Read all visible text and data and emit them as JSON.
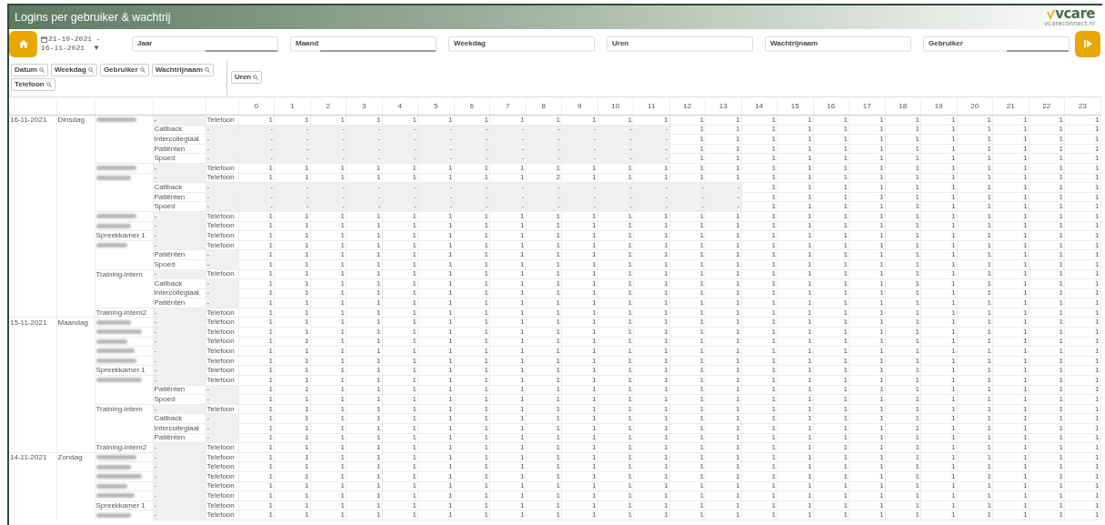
{
  "window": {
    "title": "Logins per gebruiker & wachtrij"
  },
  "logo": {
    "text": "vcare",
    "subtitle": "vcareconnect.nl"
  },
  "date_range": {
    "from_line": "21-10-2021 -",
    "to_line": "16-11-2021",
    "caret": "▼"
  },
  "filters": [
    {
      "label": "Jaar",
      "level": 0.5
    },
    {
      "label": "Maand",
      "level": 0.8
    },
    {
      "label": "Weekdag",
      "level": 0
    },
    {
      "label": "Uren",
      "level": 0
    },
    {
      "label": "Wachtrijnaam",
      "level": 0
    },
    {
      "label": "Gebruiker",
      "level": 0.43
    }
  ],
  "row_chips": [
    "Datum",
    "Weekdag",
    "Gebruiker",
    "Wachtrijnaam",
    "Telefoon"
  ],
  "column_chips": [
    "Uren"
  ],
  "hour_columns": [
    "0",
    "1",
    "2",
    "3",
    "4",
    "5",
    "6",
    "7",
    "8",
    "9",
    "10",
    "11",
    "12",
    "13",
    "14",
    "15",
    "16",
    "17",
    "18",
    "19",
    "20",
    "21",
    "22",
    "23"
  ],
  "rows": [
    {
      "date": "16-11-2021",
      "weekday": "Dinsdag",
      "user_redacted": true,
      "queue": {
        "text": "-",
        "empty": true
      },
      "phone": "Telefoon",
      "hours": [
        "1",
        "1",
        "1",
        "1",
        "1",
        "1",
        "1",
        "1",
        "1",
        "1",
        "1",
        "1",
        "1",
        "1",
        "1",
        "1",
        "1",
        "1",
        "1",
        "1",
        "1",
        "1",
        "1",
        "1"
      ]
    },
    {
      "queue": "Callback",
      "phone": {
        "text": "-",
        "empty": true
      },
      "hours": [
        {
          "text": "-",
          "empty": true
        },
        {
          "text": "-",
          "empty": true
        },
        {
          "text": "-",
          "empty": true
        },
        {
          "text": "-",
          "empty": true
        },
        {
          "text": "-",
          "empty": true
        },
        {
          "text": "-",
          "empty": true
        },
        {
          "text": "-",
          "empty": true
        },
        {
          "text": "-",
          "empty": true
        },
        {
          "text": "-",
          "empty": true
        },
        {
          "text": "-",
          "empty": true
        },
        {
          "text": "-",
          "empty": true
        },
        {
          "text": "-",
          "empty": true
        },
        "1",
        "1",
        "1",
        "1",
        "1",
        "1",
        "1",
        "1",
        "1",
        "1",
        "1",
        "1"
      ]
    },
    {
      "queue": "Intercollegiaal",
      "phone": {
        "text": "-",
        "empty": true
      },
      "hours": [
        {
          "text": "-",
          "empty": true
        },
        {
          "text": "-",
          "empty": true
        },
        {
          "text": "-",
          "empty": true
        },
        {
          "text": "-",
          "empty": true
        },
        {
          "text": "-",
          "empty": true
        },
        {
          "text": "-",
          "empty": true
        },
        {
          "text": "-",
          "empty": true
        },
        {
          "text": "-",
          "empty": true
        },
        {
          "text": "-",
          "empty": true
        },
        {
          "text": "-",
          "empty": true
        },
        {
          "text": "-",
          "empty": true
        },
        {
          "text": "-",
          "empty": true
        },
        "1",
        "1",
        "1",
        "1",
        "1",
        "1",
        "1",
        "1",
        "1",
        "1",
        "1",
        "1"
      ]
    },
    {
      "queue": "Patiënten",
      "phone": {
        "text": "-",
        "empty": true
      },
      "hours": [
        {
          "text": "-",
          "empty": true
        },
        {
          "text": "-",
          "empty": true
        },
        {
          "text": "-",
          "empty": true
        },
        {
          "text": "-",
          "empty": true
        },
        {
          "text": "-",
          "empty": true
        },
        {
          "text": "-",
          "empty": true
        },
        {
          "text": "-",
          "empty": true
        },
        {
          "text": "-",
          "empty": true
        },
        {
          "text": "-",
          "empty": true
        },
        {
          "text": "-",
          "empty": true
        },
        {
          "text": "-",
          "empty": true
        },
        {
          "text": "-",
          "empty": true
        },
        "1",
        "1",
        "1",
        "1",
        "1",
        "1",
        "1",
        "1",
        "1",
        "1",
        "1",
        "1"
      ]
    },
    {
      "queue": "Spoed",
      "phone": {
        "text": "-",
        "empty": true
      },
      "hours": [
        {
          "text": "-",
          "empty": true
        },
        {
          "text": "-",
          "empty": true
        },
        {
          "text": "-",
          "empty": true
        },
        {
          "text": "-",
          "empty": true
        },
        {
          "text": "-",
          "empty": true
        },
        {
          "text": "-",
          "empty": true
        },
        {
          "text": "-",
          "empty": true
        },
        {
          "text": "-",
          "empty": true
        },
        {
          "text": "-",
          "empty": true
        },
        {
          "text": "-",
          "empty": true
        },
        {
          "text": "-",
          "empty": true
        },
        {
          "text": "-",
          "empty": true
        },
        "1",
        "1",
        "1",
        "1",
        "1",
        "1",
        "1",
        "1",
        "1",
        "1",
        "1",
        "1"
      ]
    },
    {
      "user_redacted": true,
      "queue": {
        "text": "-",
        "empty": true
      },
      "phone": "Telefoon",
      "hours": [
        "1",
        "1",
        "1",
        "1",
        "1",
        "1",
        "1",
        "1",
        "1",
        "1",
        "1",
        "1",
        "1",
        "1",
        "1",
        "1",
        "1",
        "1",
        "1",
        "1",
        "1",
        "1",
        "1",
        "1"
      ]
    },
    {
      "user_redacted": true,
      "queue": {
        "text": "-",
        "empty": true
      },
      "phone": "Telefoon",
      "hours": [
        "1",
        "1",
        "1",
        "1",
        "1",
        "1",
        "1",
        "1",
        "2",
        "1",
        "1",
        "1",
        "1",
        "1",
        "1",
        "1",
        "1",
        "1",
        "1",
        "1",
        "1",
        "1",
        "1",
        "1"
      ]
    },
    {
      "queue": "Callback",
      "phone": {
        "text": "-",
        "empty": true
      },
      "hours": [
        {
          "text": "-",
          "empty": true
        },
        {
          "text": "-",
          "empty": true
        },
        {
          "text": "-",
          "empty": true
        },
        {
          "text": "-",
          "empty": true
        },
        {
          "text": "-",
          "empty": true
        },
        {
          "text": "-",
          "empty": true
        },
        {
          "text": "-",
          "empty": true
        },
        {
          "text": "-",
          "empty": true
        },
        {
          "text": "-",
          "empty": true
        },
        {
          "text": "-",
          "empty": true
        },
        {
          "text": "-",
          "empty": true
        },
        {
          "text": "-",
          "empty": true
        },
        {
          "text": "-",
          "empty": true
        },
        {
          "text": "-",
          "empty": true
        },
        "1",
        "1",
        "1",
        "1",
        "1",
        "1",
        "1",
        "1",
        "1",
        "1"
      ]
    },
    {
      "queue": "Patiënten",
      "phone": {
        "text": "-",
        "empty": true
      },
      "hours": [
        {
          "text": "-",
          "empty": true
        },
        {
          "text": "-",
          "empty": true
        },
        {
          "text": "-",
          "empty": true
        },
        {
          "text": "-",
          "empty": true
        },
        {
          "text": "-",
          "empty": true
        },
        {
          "text": "-",
          "empty": true
        },
        {
          "text": "-",
          "empty": true
        },
        {
          "text": "-",
          "empty": true
        },
        {
          "text": "-",
          "empty": true
        },
        {
          "text": "-",
          "empty": true
        },
        {
          "text": "-",
          "empty": true
        },
        {
          "text": "-",
          "empty": true
        },
        {
          "text": "-",
          "empty": true
        },
        {
          "text": "-",
          "empty": true
        },
        "1",
        "1",
        "1",
        "1",
        "1",
        "1",
        "1",
        "1",
        "1",
        "1"
      ]
    },
    {
      "queue": "Spoed",
      "phone": {
        "text": "-",
        "empty": true
      },
      "hours": [
        {
          "text": "-",
          "empty": true
        },
        {
          "text": "-",
          "empty": true
        },
        {
          "text": "-",
          "empty": true
        },
        {
          "text": "-",
          "empty": true
        },
        {
          "text": "-",
          "empty": true
        },
        {
          "text": "-",
          "empty": true
        },
        {
          "text": "-",
          "empty": true
        },
        {
          "text": "-",
          "empty": true
        },
        {
          "text": "-",
          "empty": true
        },
        {
          "text": "-",
          "empty": true
        },
        {
          "text": "-",
          "empty": true
        },
        {
          "text": "-",
          "empty": true
        },
        {
          "text": "-",
          "empty": true
        },
        {
          "text": "-",
          "empty": true
        },
        "1",
        "1",
        "1",
        "1",
        "1",
        "1",
        "1",
        "1",
        "1",
        "1"
      ]
    },
    {
      "user_redacted": true,
      "queue": {
        "text": "-",
        "empty": true
      },
      "phone": "Telefoon",
      "hours": [
        "1",
        "1",
        "1",
        "1",
        "1",
        "1",
        "1",
        "1",
        "1",
        "1",
        "1",
        "1",
        "1",
        "1",
        "1",
        "1",
        "1",
        "1",
        "1",
        "1",
        "1",
        "1",
        "1",
        "1"
      ]
    },
    {
      "user_redacted": true,
      "queue": {
        "text": "-",
        "empty": true
      },
      "phone": "Telefoon",
      "hours": [
        "1",
        "1",
        "1",
        "1",
        "1",
        "1",
        "1",
        "1",
        "1",
        "1",
        "1",
        "1",
        "1",
        "1",
        "1",
        "1",
        "1",
        "1",
        "1",
        "1",
        "1",
        "1",
        "1",
        "1"
      ]
    },
    {
      "user": "Spreekkamer 1",
      "queue": {
        "text": "-",
        "empty": true
      },
      "phone": "Telefoon",
      "hours": [
        "1",
        "1",
        "1",
        "1",
        "1",
        "1",
        "1",
        "1",
        "1",
        "1",
        "1",
        "1",
        "1",
        "1",
        "1",
        "1",
        "1",
        "1",
        "1",
        "1",
        "1",
        "1",
        "1",
        "1"
      ]
    },
    {
      "user_redacted": true,
      "queue": {
        "text": "-",
        "empty": true
      },
      "phone": "Telefoon",
      "hours": [
        "1",
        "1",
        "1",
        "1",
        "1",
        "1",
        "1",
        "1",
        "1",
        "1",
        "1",
        "1",
        "1",
        "1",
        "1",
        "1",
        "1",
        "1",
        "1",
        "1",
        "1",
        "1",
        "1",
        "1"
      ]
    },
    {
      "queue": "Patiënten",
      "phone": {
        "text": "-",
        "empty": true
      },
      "hours": [
        "1",
        "1",
        "1",
        "1",
        "1",
        "1",
        "1",
        "1",
        "1",
        "1",
        "1",
        "1",
        "1",
        "1",
        "1",
        "1",
        "1",
        "1",
        "1",
        "1",
        "1",
        "1",
        "1",
        "1"
      ]
    },
    {
      "queue": "Spoed",
      "phone": {
        "text": "-",
        "empty": true
      },
      "hours": [
        "1",
        "1",
        "1",
        "1",
        "1",
        "1",
        "1",
        "1",
        "1",
        "1",
        "1",
        "1",
        "1",
        "1",
        "1",
        "1",
        "1",
        "1",
        "1",
        "1",
        "1",
        "1",
        "1",
        "1"
      ]
    },
    {
      "user": "Training-intern",
      "queue": {
        "text": "-",
        "empty": true
      },
      "phone": "Telefoon",
      "hours": [
        "1",
        "1",
        "1",
        "1",
        "1",
        "1",
        "1",
        "1",
        "1",
        "1",
        "1",
        "1",
        "1",
        "1",
        "1",
        "1",
        "1",
        "1",
        "1",
        "1",
        "1",
        "1",
        "1",
        "1"
      ]
    },
    {
      "queue": "Callback",
      "phone": {
        "text": "-",
        "empty": true
      },
      "hours": [
        "1",
        "1",
        "1",
        "1",
        "1",
        "1",
        "1",
        "1",
        "1",
        "1",
        "1",
        "1",
        "1",
        "1",
        "1",
        "1",
        "1",
        "1",
        "1",
        "1",
        "1",
        "1",
        "1",
        "1"
      ]
    },
    {
      "queue": "Intercollegiaal",
      "phone": {
        "text": "-",
        "empty": true
      },
      "hours": [
        "1",
        "1",
        "1",
        "1",
        "1",
        "1",
        "1",
        "1",
        "1",
        "1",
        "1",
        "1",
        "1",
        "1",
        "1",
        "1",
        "1",
        "1",
        "1",
        "1",
        "1",
        "1",
        "1",
        "1"
      ]
    },
    {
      "queue": "Patiënten",
      "phone": {
        "text": "-",
        "empty": true
      },
      "hours": [
        "1",
        "1",
        "1",
        "1",
        "1",
        "1",
        "1",
        "1",
        "1",
        "1",
        "1",
        "1",
        "1",
        "1",
        "1",
        "1",
        "1",
        "1",
        "1",
        "1",
        "1",
        "1",
        "1",
        "1"
      ]
    },
    {
      "user": "Training-intern2",
      "queue": {
        "text": "-",
        "empty": true
      },
      "phone": "Telefoon",
      "hours": [
        "1",
        "1",
        "1",
        "1",
        "1",
        "1",
        "1",
        "1",
        "1",
        "1",
        "1",
        "1",
        "1",
        "1",
        "1",
        "1",
        "1",
        "1",
        "1",
        "1",
        "1",
        "1",
        "1",
        "1"
      ]
    },
    {
      "date": "15-11-2021",
      "weekday": "Maandag",
      "user_redacted": true,
      "queue": {
        "text": "-",
        "empty": true
      },
      "phone": "Telefoon",
      "hours": [
        "1",
        "1",
        "1",
        "1",
        "1",
        "1",
        "1",
        "1",
        "1",
        "1",
        "1",
        "1",
        "1",
        "1",
        "1",
        "1",
        "1",
        "1",
        "1",
        "1",
        "1",
        "1",
        "1",
        "1"
      ]
    },
    {
      "user_redacted": true,
      "queue": {
        "text": "-",
        "empty": true
      },
      "phone": "Telefoon",
      "hours": [
        "1",
        "1",
        "1",
        "1",
        "1",
        "1",
        "1",
        "1",
        "1",
        "1",
        "1",
        "1",
        "1",
        "1",
        "1",
        "1",
        "1",
        "1",
        "1",
        "1",
        "1",
        "1",
        "1",
        "1"
      ]
    },
    {
      "user_redacted": true,
      "queue": {
        "text": "-",
        "empty": true
      },
      "phone": "Telefoon",
      "hours": [
        "1",
        "1",
        "1",
        "1",
        "1",
        "1",
        "1",
        "1",
        "1",
        "1",
        "1",
        "1",
        "1",
        "1",
        "1",
        "1",
        "1",
        "1",
        "1",
        "1",
        "1",
        "1",
        "1",
        "1"
      ]
    },
    {
      "user_redacted": true,
      "queue": {
        "text": "-",
        "empty": true
      },
      "phone": "Telefoon",
      "hours": [
        "1",
        "1",
        "1",
        "1",
        "1",
        "1",
        "1",
        "1",
        "1",
        "1",
        "1",
        "1",
        "1",
        "1",
        "1",
        "1",
        "1",
        "1",
        "1",
        "1",
        "1",
        "1",
        "1",
        "1"
      ]
    },
    {
      "user_redacted": true,
      "queue": {
        "text": "-",
        "empty": true
      },
      "phone": "Telefoon",
      "hours": [
        "1",
        "1",
        "1",
        "1",
        "1",
        "1",
        "1",
        "1",
        "1",
        "1",
        "1",
        "1",
        "1",
        "1",
        "1",
        "1",
        "1",
        "1",
        "1",
        "1",
        "1",
        "1",
        "1",
        "1"
      ]
    },
    {
      "user": "Spreekkamer 1",
      "queue": {
        "text": "-",
        "empty": true
      },
      "phone": "Telefoon",
      "hours": [
        "1",
        "1",
        "1",
        "1",
        "1",
        "1",
        "1",
        "1",
        "1",
        "1",
        "1",
        "1",
        "1",
        "1",
        "1",
        "1",
        "1",
        "1",
        "1",
        "1",
        "1",
        "1",
        "1",
        "1"
      ]
    },
    {
      "user_redacted": true,
      "queue": {
        "text": "-",
        "empty": true
      },
      "phone": "Telefoon",
      "hours": [
        "1",
        "1",
        "1",
        "1",
        "1",
        "1",
        "1",
        "1",
        "1",
        "1",
        "1",
        "1",
        "1",
        "1",
        "1",
        "1",
        "1",
        "1",
        "1",
        "1",
        "1",
        "1",
        "1",
        "1"
      ]
    },
    {
      "queue": "Patiënten",
      "phone": {
        "text": "-",
        "empty": true
      },
      "hours": [
        "1",
        "1",
        "1",
        "1",
        "1",
        "1",
        "1",
        "1",
        "1",
        "1",
        "1",
        "1",
        "1",
        "1",
        "1",
        "1",
        "1",
        "1",
        "1",
        "1",
        "1",
        "1",
        "1",
        "1"
      ]
    },
    {
      "queue": "Spoed",
      "phone": {
        "text": "-",
        "empty": true
      },
      "hours": [
        "1",
        "1",
        "1",
        "1",
        "1",
        "1",
        "1",
        "1",
        "1",
        "1",
        "1",
        "1",
        "1",
        "1",
        "1",
        "1",
        "1",
        "1",
        "1",
        "1",
        "1",
        "1",
        "1",
        "1"
      ]
    },
    {
      "user": "Training-intern",
      "queue": {
        "text": "-",
        "empty": true
      },
      "phone": "Telefoon",
      "hours": [
        "1",
        "1",
        "1",
        "1",
        "1",
        "1",
        "1",
        "1",
        "1",
        "1",
        "1",
        "1",
        "1",
        "1",
        "1",
        "1",
        "1",
        "1",
        "1",
        "1",
        "1",
        "1",
        "1",
        "1"
      ]
    },
    {
      "queue": "Callback",
      "phone": {
        "text": "-",
        "empty": true
      },
      "hours": [
        "1",
        "1",
        "1",
        "1",
        "1",
        "1",
        "1",
        "1",
        "1",
        "1",
        "1",
        "1",
        "1",
        "1",
        "1",
        "1",
        "1",
        "1",
        "1",
        "1",
        "1",
        "1",
        "1",
        "1"
      ]
    },
    {
      "queue": "Intercollegiaal",
      "phone": {
        "text": "-",
        "empty": true
      },
      "hours": [
        "1",
        "1",
        "1",
        "1",
        "1",
        "1",
        "1",
        "1",
        "1",
        "1",
        "1",
        "1",
        "1",
        "1",
        "1",
        "1",
        "1",
        "1",
        "1",
        "1",
        "1",
        "1",
        "1",
        "1"
      ]
    },
    {
      "queue": "Patiënten",
      "phone": {
        "text": "-",
        "empty": true
      },
      "hours": [
        "1",
        "1",
        "1",
        "1",
        "1",
        "1",
        "1",
        "1",
        "1",
        "1",
        "1",
        "1",
        "1",
        "1",
        "1",
        "1",
        "1",
        "1",
        "1",
        "1",
        "1",
        "1",
        "1",
        "1"
      ]
    },
    {
      "user": "Training-intern2",
      "queue": {
        "text": "-",
        "empty": true
      },
      "phone": "Telefoon",
      "hours": [
        "1",
        "1",
        "1",
        "1",
        "1",
        "1",
        "1",
        "1",
        "1",
        "1",
        "1",
        "1",
        "1",
        "1",
        "1",
        "1",
        "1",
        "1",
        "1",
        "1",
        "1",
        "1",
        "1",
        "1"
      ]
    },
    {
      "date": "14-11-2021",
      "weekday": "Zondag",
      "user_redacted": true,
      "queue": {
        "text": "-",
        "empty": true
      },
      "phone": "Telefoon",
      "hours": [
        "1",
        "1",
        "1",
        "1",
        "1",
        "1",
        "1",
        "1",
        "1",
        "1",
        "1",
        "1",
        "1",
        "1",
        "1",
        "1",
        "1",
        "1",
        "1",
        "1",
        "1",
        "1",
        "1",
        "1"
      ]
    },
    {
      "user_redacted": true,
      "queue": {
        "text": "-",
        "empty": true
      },
      "phone": "Telefoon",
      "hours": [
        "1",
        "1",
        "1",
        "1",
        "1",
        "1",
        "1",
        "1",
        "1",
        "1",
        "1",
        "1",
        "1",
        "1",
        "1",
        "1",
        "1",
        "1",
        "1",
        "1",
        "1",
        "1",
        "1",
        "1"
      ]
    },
    {
      "user_redacted": true,
      "queue": {
        "text": "-",
        "empty": true
      },
      "phone": "Telefoon",
      "hours": [
        "1",
        "1",
        "1",
        "1",
        "1",
        "1",
        "1",
        "1",
        "1",
        "1",
        "1",
        "1",
        "1",
        "1",
        "1",
        "1",
        "1",
        "1",
        "1",
        "1",
        "1",
        "1",
        "1",
        "1"
      ]
    },
    {
      "user_redacted": true,
      "queue": {
        "text": "-",
        "empty": true
      },
      "phone": "Telefoon",
      "hours": [
        "1",
        "1",
        "1",
        "1",
        "1",
        "1",
        "1",
        "1",
        "1",
        "1",
        "1",
        "1",
        "1",
        "1",
        "1",
        "1",
        "1",
        "1",
        "1",
        "1",
        "1",
        "1",
        "1",
        "1"
      ]
    },
    {
      "user_redacted": true,
      "queue": {
        "text": "-",
        "empty": true
      },
      "phone": "Telefoon",
      "hours": [
        "1",
        "1",
        "1",
        "1",
        "1",
        "1",
        "1",
        "1",
        "1",
        "1",
        "1",
        "1",
        "1",
        "1",
        "1",
        "1",
        "1",
        "1",
        "1",
        "1",
        "1",
        "1",
        "1",
        "1"
      ]
    },
    {
      "user": "Spreekkamer 1",
      "queue": {
        "text": "-",
        "empty": true
      },
      "phone": "Telefoon",
      "hours": [
        "1",
        "1",
        "1",
        "1",
        "1",
        "1",
        "1",
        "1",
        "1",
        "1",
        "1",
        "1",
        "1",
        "1",
        "1",
        "1",
        "1",
        "1",
        "1",
        "1",
        "1",
        "1",
        "1",
        "1"
      ]
    },
    {
      "user_redacted": true,
      "queue": {
        "text": "-",
        "empty": true
      },
      "phone": "Telefoon",
      "hours": [
        "1",
        "1",
        "1",
        "1",
        "1",
        "1",
        "1",
        "1",
        "1",
        "1",
        "1",
        "1",
        "1",
        "1",
        "1",
        "1",
        "1",
        "1",
        "1",
        "1",
        "1",
        "1",
        "1",
        "1"
      ]
    }
  ]
}
